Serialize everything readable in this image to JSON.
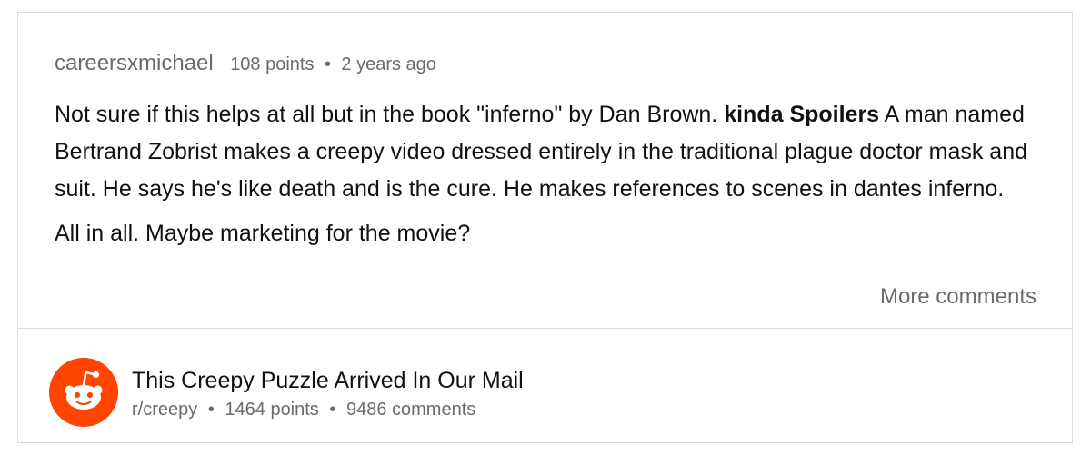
{
  "comment": {
    "author": "careersxmichael",
    "points": "108 points",
    "separator": "•",
    "age": "2 years ago",
    "paragraph1_before": "Not sure if this helps at all but in the book \"inferno\" by Dan Brown. ",
    "paragraph1_bold": "kinda Spoilers",
    "paragraph1_after": " A man named Bertrand Zobrist makes a creepy video dressed entirely in the traditional plague doctor mask and suit. He says he's like death and is the cure. He makes references to scenes in dantes inferno.",
    "paragraph2": "All in all. Maybe marketing for the movie?",
    "more_comments_label": "More comments"
  },
  "post": {
    "title": "This Creepy Puzzle Arrived In Our Mail",
    "subreddit": "r/creepy",
    "separator": "•",
    "points": "1464 points",
    "comments": "9486 comments",
    "avatar_icon": "reddit-alien-icon",
    "brand_color": "#ff4500"
  }
}
